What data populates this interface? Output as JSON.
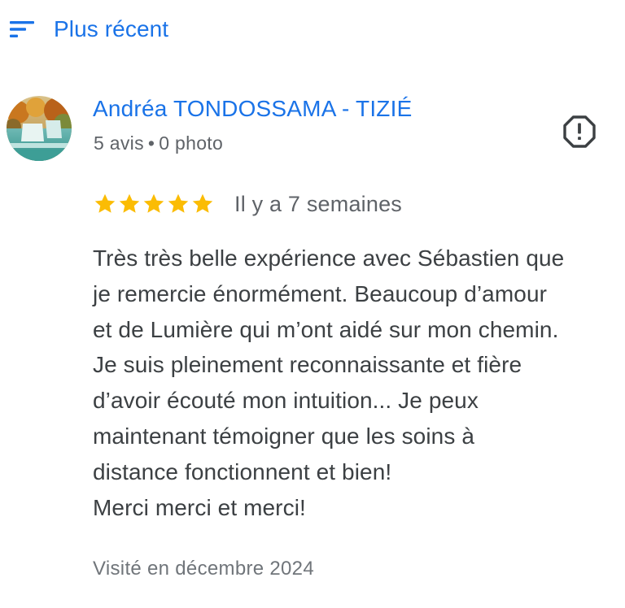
{
  "sort": {
    "icon": "sort-icon",
    "label": "Plus récent"
  },
  "review": {
    "author": {
      "name": "Andréa TONDOSSAMA - TIZIÉ",
      "reviews_count": "5 avis",
      "separator": "•",
      "photos_count": "0 photo",
      "avatar": "avatar-landscape-waterfall"
    },
    "report_icon": "report-icon",
    "rating": 5,
    "rating_max": 5,
    "star_color": "#fbbc04",
    "date": "Il y a 7 semaines",
    "text_lines": [
      "Très très belle expérience avec Sébastien que",
      "je remercie énormément. Beaucoup d’amour",
      "et de Lumière qui m’ont aidé sur mon chemin.",
      "Je suis pleinement reconnaissante et fière",
      "d’avoir écouté mon intuition... Je peux",
      "maintenant témoigner que les soins à",
      "distance fonctionnent et bien!",
      "Merci merci et merci!"
    ],
    "visit": "Visité en décembre 2024"
  },
  "colors": {
    "accent": "#1a73e8",
    "text": "#3c4043",
    "secondary": "#5f6368"
  }
}
